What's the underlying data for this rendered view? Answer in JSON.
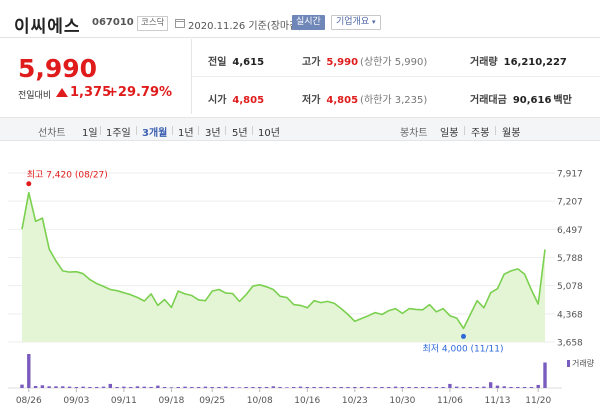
{
  "header": {
    "stock_name": "이씨에스",
    "stock_code": "067010",
    "market": "코스닥",
    "date": "2020.11.26 기준(장마감)",
    "live_button": "실시간",
    "info_button": "기업개요"
  },
  "price": {
    "current": "5,990",
    "diff_label": "전일대비",
    "diff_value": "1,375",
    "diff_percent": "+29.79%",
    "up_color": "#e01b1b"
  },
  "stats": {
    "prev_close": {
      "label": "전일",
      "value": "4,615"
    },
    "open": {
      "label": "시가",
      "value": "4,805"
    },
    "high": {
      "label": "고가",
      "value": "5,990",
      "sub": "(상한가 5,990)"
    },
    "low": {
      "label": "저가",
      "value": "4,805",
      "sub": "(하한가 3,235)"
    },
    "volume": {
      "label": "거래량",
      "value": "16,210,227"
    },
    "amount": {
      "label": "거래대금",
      "value": "90,616",
      "unit": "백만"
    }
  },
  "period_bar": {
    "line_label": "선차트",
    "line_items": [
      "1일",
      "1주일",
      "3개월",
      "1년",
      "3년",
      "5년",
      "10년"
    ],
    "active_item": "3개월",
    "candle_label": "봉차트",
    "candle_items": [
      "일봉",
      "주봉",
      "월봉"
    ]
  },
  "chart_data": {
    "type": "area",
    "y_ticks": [
      "7,917",
      "7,207",
      "6,497",
      "5,788",
      "5,078",
      "4,368",
      "3,658"
    ],
    "x_ticks": [
      "08/26",
      "09/03",
      "09/11",
      "09/18",
      "09/25",
      "10/08",
      "10/16",
      "10/23",
      "10/30",
      "11/06",
      "11/13",
      "11/20"
    ],
    "ylim": [
      3658,
      7917
    ],
    "high_annotation": "최고 7,420 (08/27)",
    "low_annotation": "최저 4,000 (11/11)",
    "high_value": 7420,
    "low_value": 4000,
    "values": [
      6500,
      7420,
      6700,
      6780,
      6000,
      5700,
      5450,
      5420,
      5430,
      5380,
      5230,
      5130,
      5060,
      4980,
      4950,
      4900,
      4850,
      4780,
      4690,
      4870,
      4580,
      4730,
      4530,
      4940,
      4870,
      4830,
      4720,
      4700,
      4940,
      4980,
      4890,
      4880,
      4680,
      4850,
      5070,
      5100,
      5050,
      4980,
      4810,
      4780,
      4600,
      4580,
      4520,
      4700,
      4650,
      4680,
      4630,
      4500,
      4350,
      4180,
      4250,
      4320,
      4400,
      4350,
      4450,
      4500,
      4380,
      4500,
      4480,
      4470,
      4600,
      4420,
      4500,
      4320,
      4260,
      4000,
      4350,
      4700,
      4520,
      4900,
      5000,
      5370,
      5450,
      5500,
      5370,
      4970,
      4615,
      5990
    ],
    "volume_label": "거래량",
    "volumes": [
      10,
      100,
      6,
      8,
      5,
      5,
      5,
      4,
      3,
      4,
      3,
      3,
      4,
      12,
      3,
      4,
      3,
      5,
      4,
      3,
      7,
      3,
      2,
      3,
      4,
      3,
      3,
      4,
      3,
      3,
      4,
      3,
      2,
      3,
      3,
      3,
      3,
      5,
      3,
      2,
      3,
      4,
      3,
      3,
      3,
      3,
      3,
      3,
      3,
      3,
      3,
      3,
      3,
      3,
      3,
      4,
      3,
      3,
      3,
      3,
      3,
      3,
      3,
      12,
      4,
      3,
      3,
      3,
      4,
      17,
      7,
      5,
      3,
      3,
      3,
      3,
      9,
      75
    ],
    "line_color": "#7bd04f",
    "fill_color": "#e4f5d6",
    "volume_color": "#7a5bbf"
  }
}
